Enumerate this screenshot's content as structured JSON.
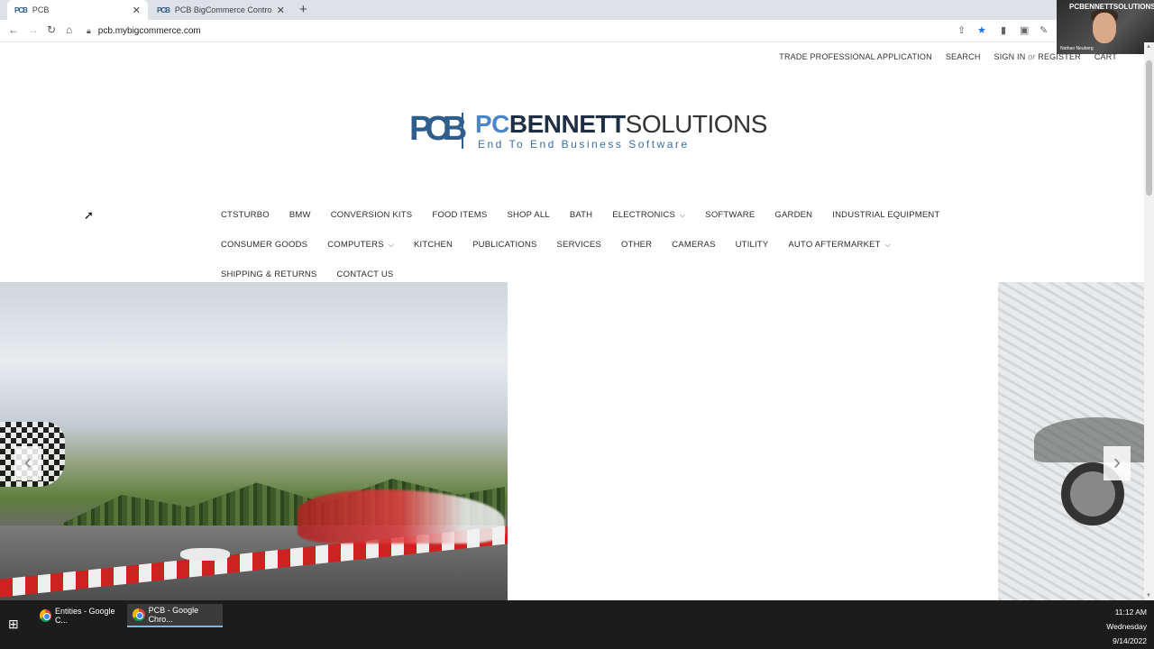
{
  "browser": {
    "tabs": [
      {
        "favicon": "PCB",
        "title": "PCB",
        "active": true
      },
      {
        "favicon": "PCB",
        "title": "PCB BigCommerce Control Panel",
        "active": false
      }
    ],
    "url": "pcb.mybigcommerce.com"
  },
  "webcam": {
    "logo_text": "PCBENNETTSOLUTIONS",
    "name": "Nathan Neuberg"
  },
  "site": {
    "utility_links": {
      "trade": "TRADE PROFESSIONAL APPLICATION",
      "search": "SEARCH",
      "sign_in": "SIGN IN",
      "or": "or",
      "register": "REGISTER",
      "cart": "CART"
    },
    "logo": {
      "mark": "PCB",
      "word_pc": "PC",
      "word_bennett": "BENNETT",
      "word_solutions": "SOLUTIONS",
      "tagline": "End To End Business Software"
    },
    "nav_rows": [
      [
        {
          "label": "CTSTURBO",
          "dropdown": false
        },
        {
          "label": "BMW",
          "dropdown": false
        },
        {
          "label": "CONVERSION KITS",
          "dropdown": false
        },
        {
          "label": "FOOD ITEMS",
          "dropdown": false
        },
        {
          "label": "SHOP ALL",
          "dropdown": false
        },
        {
          "label": "BATH",
          "dropdown": false
        },
        {
          "label": "ELECTRONICS",
          "dropdown": true
        },
        {
          "label": "SOFTWARE",
          "dropdown": false
        },
        {
          "label": "GARDEN",
          "dropdown": false
        },
        {
          "label": "INDUSTRIAL EQUIPMENT",
          "dropdown": false
        }
      ],
      [
        {
          "label": "CONSUMER GOODS",
          "dropdown": false
        },
        {
          "label": "COMPUTERS",
          "dropdown": true
        },
        {
          "label": "KITCHEN",
          "dropdown": false
        },
        {
          "label": "PUBLICATIONS",
          "dropdown": false
        },
        {
          "label": "SERVICES",
          "dropdown": false
        },
        {
          "label": "OTHER",
          "dropdown": false
        },
        {
          "label": "CAMERAS",
          "dropdown": false
        },
        {
          "label": "UTILITY",
          "dropdown": false
        },
        {
          "label": "AUTO AFTERMARKET",
          "dropdown": true
        }
      ],
      [
        {
          "label": "SHIPPING & RETURNS",
          "dropdown": false
        },
        {
          "label": "CONTACT US",
          "dropdown": false
        }
      ]
    ],
    "carousel": {
      "prev_icon": "chevron-left-icon",
      "next_icon": "chevron-right-icon"
    }
  },
  "taskbar": {
    "items": [
      {
        "label": "Entities - Google C...",
        "active": false
      },
      {
        "label": "PCB - Google Chro...",
        "active": true
      }
    ],
    "time": "11:12 AM",
    "day": "Wednesday",
    "date": "9/14/2022"
  }
}
